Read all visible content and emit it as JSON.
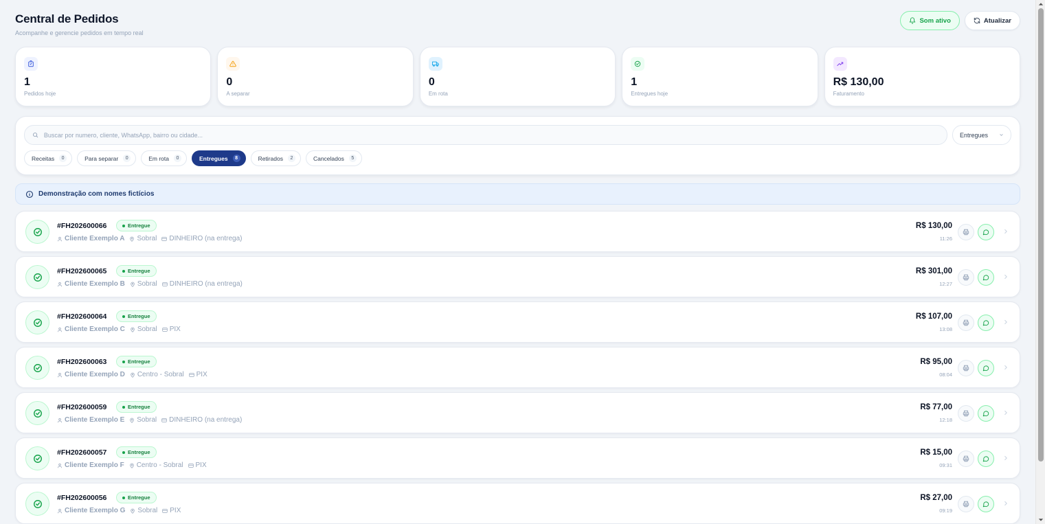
{
  "header": {
    "title": "Central de Pedidos",
    "subtitle": "Acompanhe e gerencie pedidos em tempo real",
    "sound_label": "Som ativo",
    "refresh_label": "Atualizar"
  },
  "stats": [
    {
      "value": "1",
      "label": "Pedidos hoje",
      "icon": "bag-icon",
      "color": "#3b5bdb"
    },
    {
      "value": "0",
      "label": "A separar",
      "icon": "warning-icon",
      "color": "#f59e0b"
    },
    {
      "value": "0",
      "label": "Em rota",
      "icon": "truck-icon",
      "color": "#0ea5e9"
    },
    {
      "value": "1",
      "label": "Entregues hoje",
      "icon": "check-circle-icon",
      "color": "#16a34a"
    },
    {
      "value": "R$ 130,00",
      "label": "Faturamento",
      "icon": "trending-up-icon",
      "color": "#7c3aed"
    }
  ],
  "search": {
    "placeholder": "Buscar por numero, cliente, WhatsApp, bairro ou cidade..."
  },
  "status_select": {
    "value": "Entregues"
  },
  "chips": [
    {
      "label": "Receitas",
      "count": "0",
      "active": false
    },
    {
      "label": "Para separar",
      "count": "0",
      "active": false
    },
    {
      "label": "Em rota",
      "count": "0",
      "active": false
    },
    {
      "label": "Entregues",
      "count": "8",
      "active": true
    },
    {
      "label": "Retirados",
      "count": "2",
      "active": false
    },
    {
      "label": "Cancelados",
      "count": "5",
      "active": false
    }
  ],
  "banner": {
    "text": "Demonstração com nomes fictícios"
  },
  "orders": [
    {
      "id": "#FH202600066",
      "status": "Entregue",
      "customer": "Cliente Exemplo A",
      "location": "Sobral",
      "payment": "DINHEIRO (na entrega)",
      "total": "R$ 130,00",
      "time": "11:26"
    },
    {
      "id": "#FH202600065",
      "status": "Entregue",
      "customer": "Cliente Exemplo B",
      "location": "Sobral",
      "payment": "DINHEIRO (na entrega)",
      "total": "R$ 301,00",
      "time": "12:27"
    },
    {
      "id": "#FH202600064",
      "status": "Entregue",
      "customer": "Cliente Exemplo C",
      "location": "Sobral",
      "payment": "PIX",
      "total": "R$ 107,00",
      "time": "13:08"
    },
    {
      "id": "#FH202600063",
      "status": "Entregue",
      "customer": "Cliente Exemplo D",
      "location": "Centro - Sobral",
      "payment": "PIX",
      "total": "R$ 95,00",
      "time": "08:04"
    },
    {
      "id": "#FH202600059",
      "status": "Entregue",
      "customer": "Cliente Exemplo E",
      "location": "Sobral",
      "payment": "DINHEIRO (na entrega)",
      "total": "R$ 77,00",
      "time": "12:18"
    },
    {
      "id": "#FH202600057",
      "status": "Entregue",
      "customer": "Cliente Exemplo F",
      "location": "Centro - Sobral",
      "payment": "PIX",
      "total": "R$ 15,00",
      "time": "09:31"
    },
    {
      "id": "#FH202600056",
      "status": "Entregue",
      "customer": "Cliente Exemplo G",
      "location": "Sobral",
      "payment": "PIX",
      "total": "R$ 27,00",
      "time": "09:19"
    }
  ]
}
